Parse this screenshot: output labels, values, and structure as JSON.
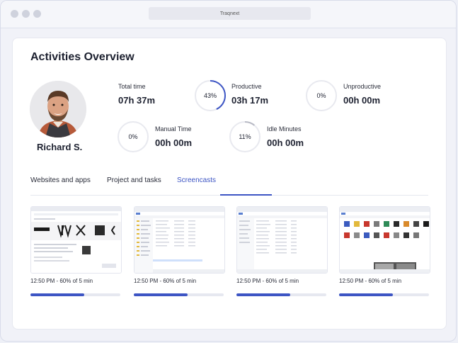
{
  "window": {
    "url_title": "Traqnext"
  },
  "page": {
    "title": "Activities Overview"
  },
  "user": {
    "name": "Richard S."
  },
  "stats": {
    "total_time": {
      "label": "Total time",
      "value": "07h 37m"
    },
    "productive": {
      "label": "Productive",
      "value": "03h 17m",
      "percent_label": "43%",
      "percent": 43
    },
    "unproductive": {
      "label": "Unproductive",
      "value": "00h 00m",
      "percent_label": "0%",
      "percent": 0
    },
    "manual_time": {
      "label": "Manual Time",
      "value": "00h 00m",
      "percent_label": "0%",
      "percent": 0
    },
    "idle_minutes": {
      "label": "Idle Minutes",
      "value": "00h 00m",
      "percent_label": "11%",
      "percent": 11
    }
  },
  "tabs": [
    {
      "label": "Websites and apps",
      "active": false
    },
    {
      "label": "Project and tasks",
      "active": false
    },
    {
      "label": "Screencasts",
      "active": true
    }
  ],
  "screencasts": [
    {
      "caption": "12:50 PM - 60% of 5 min",
      "progress": 0.6
    },
    {
      "caption": "12:50 PM - 60% of 5 min",
      "progress": 0.6
    },
    {
      "caption": "12:50 PM - 60% of 5 min",
      "progress": 0.6
    },
    {
      "caption": "12:50 PM - 60% of 5 min",
      "progress": 0.6
    }
  ],
  "colors": {
    "accent": "#3d55c4",
    "ring_track": "#e8e9ef",
    "idle_ring": "#b7b9c4"
  }
}
